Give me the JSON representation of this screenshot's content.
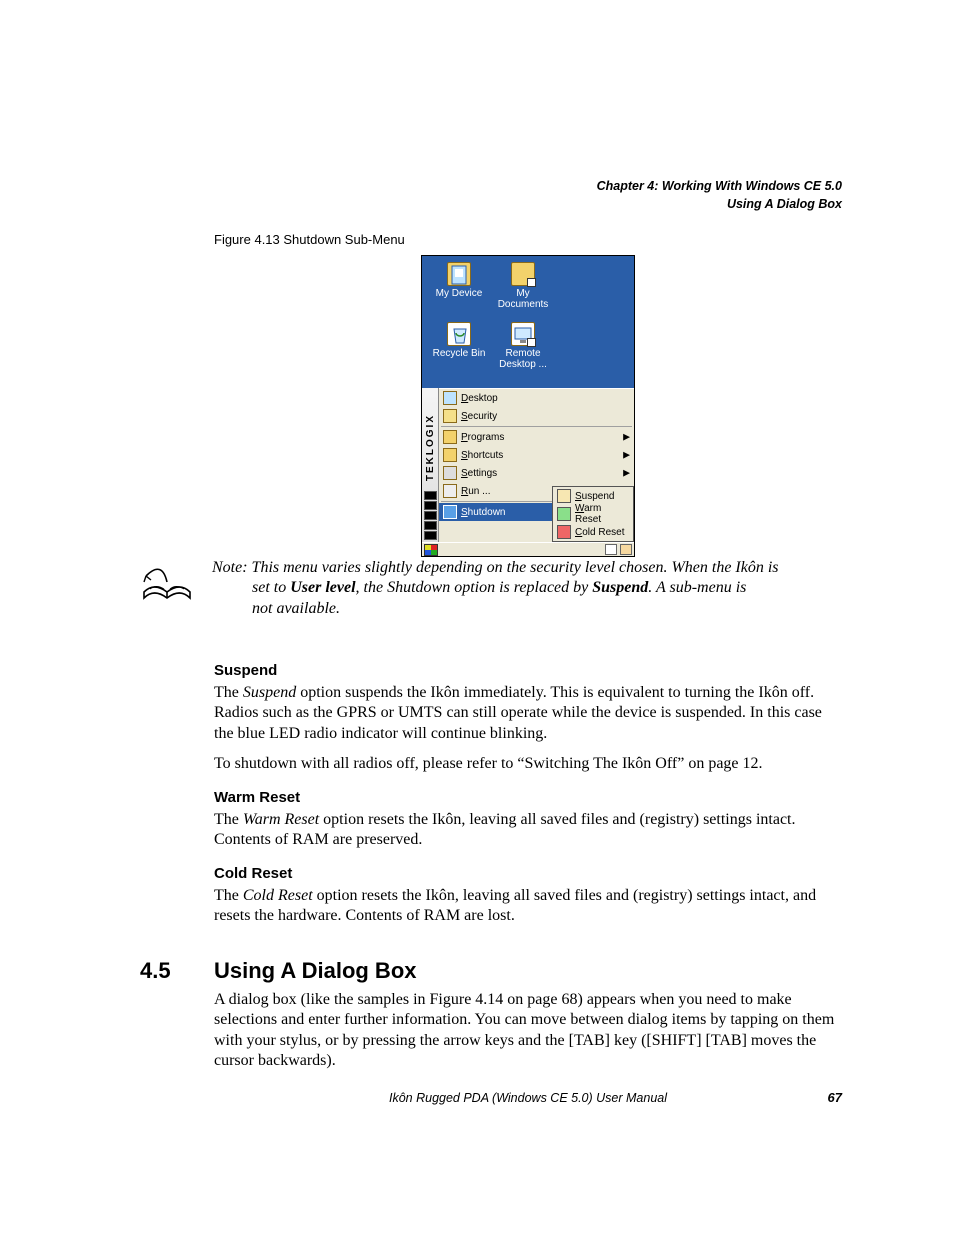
{
  "header": {
    "line1": "Chapter 4: Working With Windows CE 5.0",
    "line2": "Using A Dialog Box"
  },
  "figure": {
    "caption": "Figure 4.13 Shutdown Sub-Menu"
  },
  "ce": {
    "desktop_icons": [
      {
        "label": "My Device"
      },
      {
        "label": "My Documents"
      },
      {
        "label": "Recycle Bin"
      },
      {
        "label": "Remote Desktop ..."
      }
    ],
    "sidebar_brand": "TEKLOGIX",
    "menu": [
      {
        "label": "Desktop",
        "arrow": false
      },
      {
        "label": "Security",
        "arrow": false
      },
      {
        "label": "Programs",
        "arrow": true
      },
      {
        "label": "Shortcuts",
        "arrow": true
      },
      {
        "label": "Settings",
        "arrow": true
      },
      {
        "label": "Run ...",
        "arrow": false
      },
      {
        "label": "Shutdown",
        "arrow": true,
        "selected": true
      }
    ],
    "submenu": [
      {
        "label": "Suspend"
      },
      {
        "label": "Warm Reset"
      },
      {
        "label": "Cold Reset"
      }
    ]
  },
  "note": {
    "prefix": "Note:",
    "line1_rest": " This menu varies slightly depending on the security level chosen. When the Ikôn is",
    "line2_a": "set to ",
    "line2_b": "User level",
    "line2_c": ", the Shutdown option is replaced by ",
    "line2_d": "Suspend",
    "line2_e": ". A sub-menu is",
    "line3": "not available."
  },
  "sections": {
    "suspend": {
      "title": "Suspend",
      "p1_a": "The ",
      "p1_b": "Suspend",
      "p1_c": " option suspends the Ikôn immediately. This is equivalent to turning the Ikôn off. Radios such as the GPRS or UMTS can still operate while the device is suspended. In this case the blue LED radio indicator will continue blinking.",
      "p2": "To shutdown with all radios off, please refer to “Switching The Ikôn Off” on page 12."
    },
    "warm": {
      "title": "Warm Reset",
      "p1_a": "The ",
      "p1_b": "Warm Reset",
      "p1_c": " option resets the Ikôn, leaving all saved files and (registry) settings intact. Contents of RAM are preserved."
    },
    "cold": {
      "title": "Cold Reset",
      "p1_a": "The ",
      "p1_b": "Cold Reset",
      "p1_c": " option resets the Ikôn, leaving all saved files and (registry) settings intact, and resets the hardware. Contents of RAM are lost."
    }
  },
  "h2": {
    "num": "4.5",
    "title": "Using A Dialog Box",
    "p": "A dialog box (like the samples in Figure 4.14 on page 68) appears when you need to make selections and enter further information. You can move between dialog items by tapping on them with your stylus, or by pressing the arrow keys and the [TAB] key ([SHIFT] [TAB] moves the cursor backwards)."
  },
  "footer": {
    "center": "Ikôn Rugged PDA (Windows CE 5.0) User Manual",
    "page": "67"
  }
}
